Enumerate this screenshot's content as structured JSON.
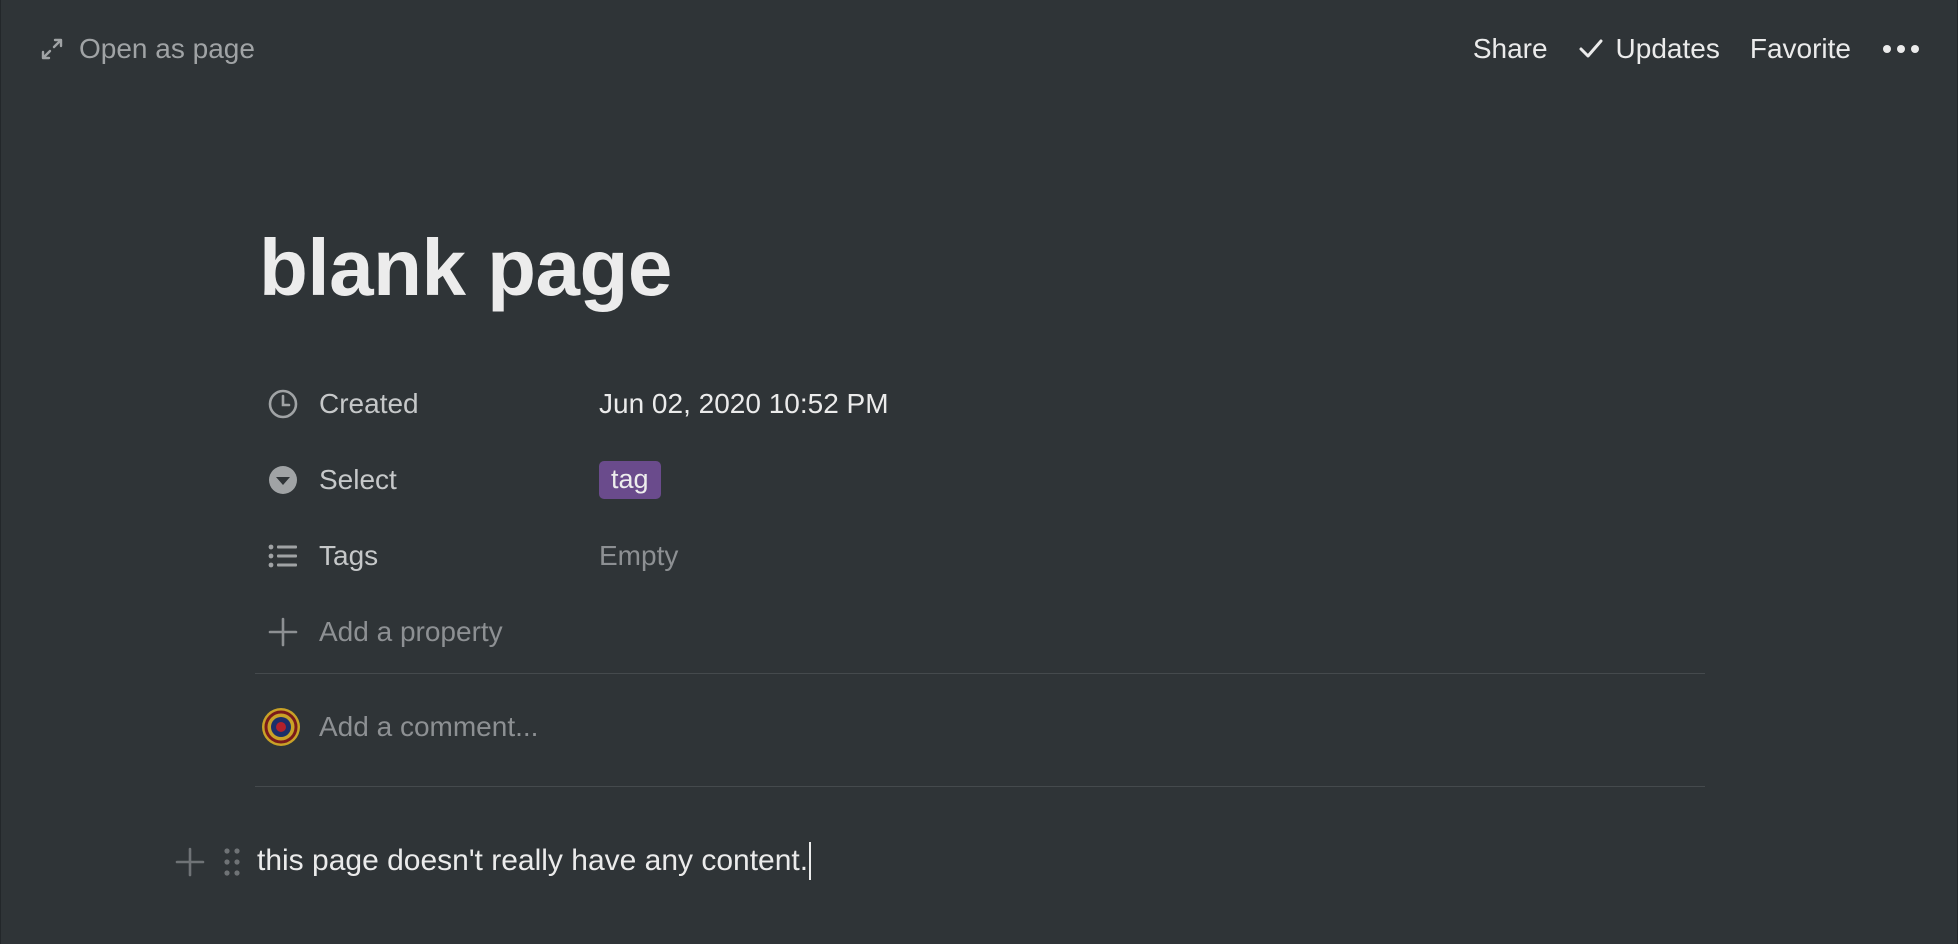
{
  "topbar": {
    "open_as_page": "Open as page",
    "share": "Share",
    "updates": "Updates",
    "favorite": "Favorite"
  },
  "page": {
    "title": "blank page"
  },
  "properties": [
    {
      "icon": "clock-icon",
      "name": "Created",
      "value": "Jun 02, 2020 10:52 PM"
    },
    {
      "icon": "select-icon",
      "name": "Select",
      "value": "tag"
    },
    {
      "icon": "list-icon",
      "name": "Tags",
      "value": "Empty"
    }
  ],
  "add_property": "Add a property",
  "comment": {
    "placeholder": "Add a comment..."
  },
  "content": {
    "text": "this page doesn't really have any content."
  },
  "colors": {
    "background": "#2f3437",
    "tag_pill": "#6a4b8c"
  }
}
